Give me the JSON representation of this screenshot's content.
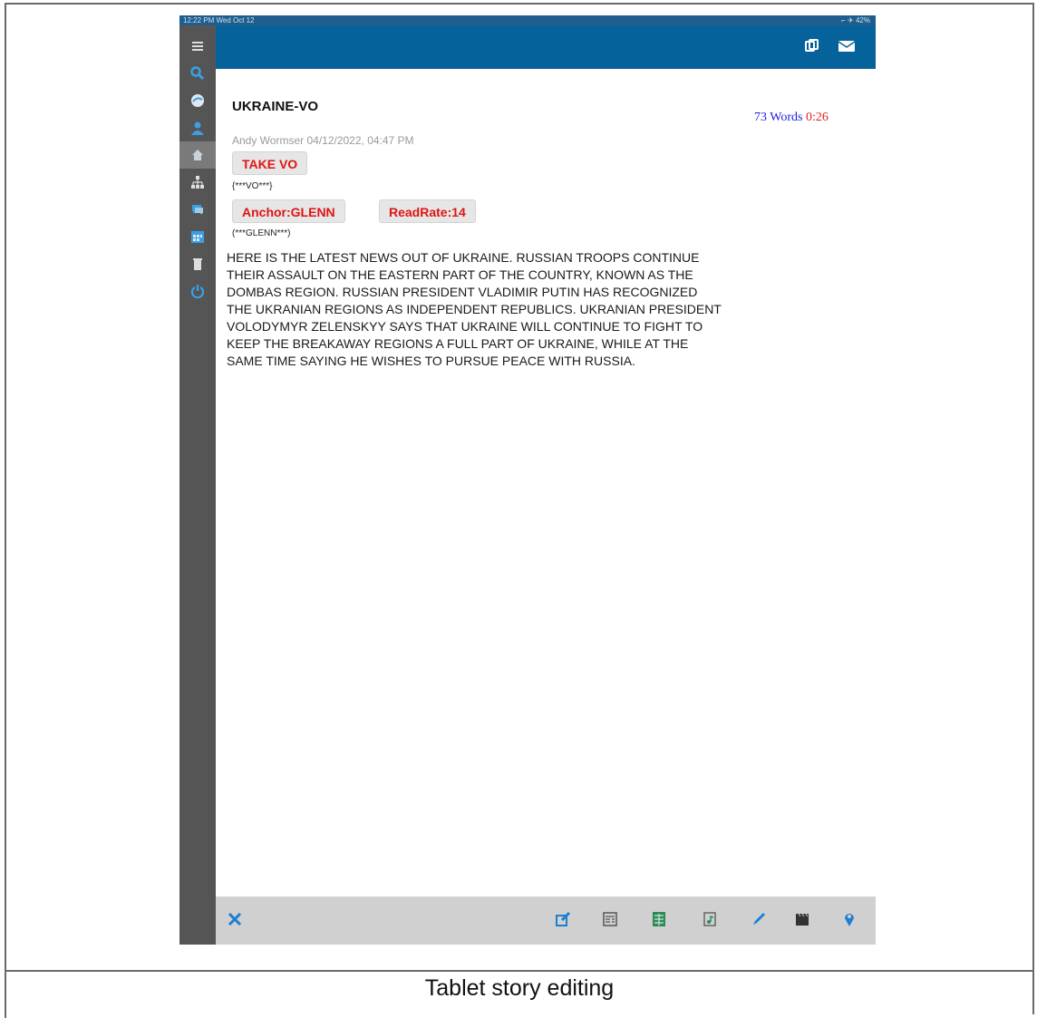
{
  "status_bar": {
    "time": "12:22 PM  Wed Oct 12",
    "right": "⌐ ✈ 42%"
  },
  "story": {
    "title": "UKRAINE-VO",
    "word_count": "73 Words",
    "read_time": "0:26",
    "byline": "Andy Wormser 04/12/2022, 04:47 PM",
    "take_vo_label": "TAKE VO",
    "vo_marker": "{***VO***}",
    "anchor_chip": "Anchor:GLENN",
    "readrate_chip": "ReadRate:14",
    "anchor_marker": "(***GLENN***)",
    "body_lines": [
      "HERE IS THE LATEST NEWS OUT OF UKRAINE. RUSSIAN TROOPS CONTINUE",
      "THEIR ASSAULT ON THE EASTERN PART OF THE COUNTRY, KNOWN AS THE",
      "DOMBAS REGION. RUSSIAN PRESIDENT VLADIMIR PUTIN HAS RECOGNIZED",
      "THE UKRANIAN REGIONS AS INDEPENDENT REPUBLICS. UKRANIAN PRESIDENT",
      "VOLODYMYR ZELENSKYY SAYS THAT UKRAINE WILL CONTINUE TO FIGHT TO",
      "KEEP THE BREAKAWAY REGIONS A FULL PART OF UKRAINE, WHILE AT THE",
      "SAME TIME SAYING HE WISHES TO PURSUE PEACE WITH RUSSIA."
    ]
  },
  "caption": "Tablet story editing",
  "colors": {
    "topbar": "#06629a",
    "sidebar": "#555555",
    "sidebar_icon": "#3aa0e6",
    "chip_text": "#e01414",
    "bottombar": "#d0d0d0"
  },
  "icons": {
    "sidebar": [
      "menu-icon",
      "search-icon",
      "globe-icon",
      "person-icon",
      "home-icon",
      "hierarchy-icon",
      "chat-icon",
      "calendar-icon",
      "trash-icon",
      "power-icon"
    ],
    "topbar": [
      "copy-icon",
      "mail-icon"
    ],
    "bottombar": [
      "close-icon",
      "edit-icon",
      "script-icon",
      "spreadsheet-icon",
      "audio-file-icon",
      "pen-icon",
      "clapperboard-icon",
      "map-pin-icon"
    ]
  }
}
